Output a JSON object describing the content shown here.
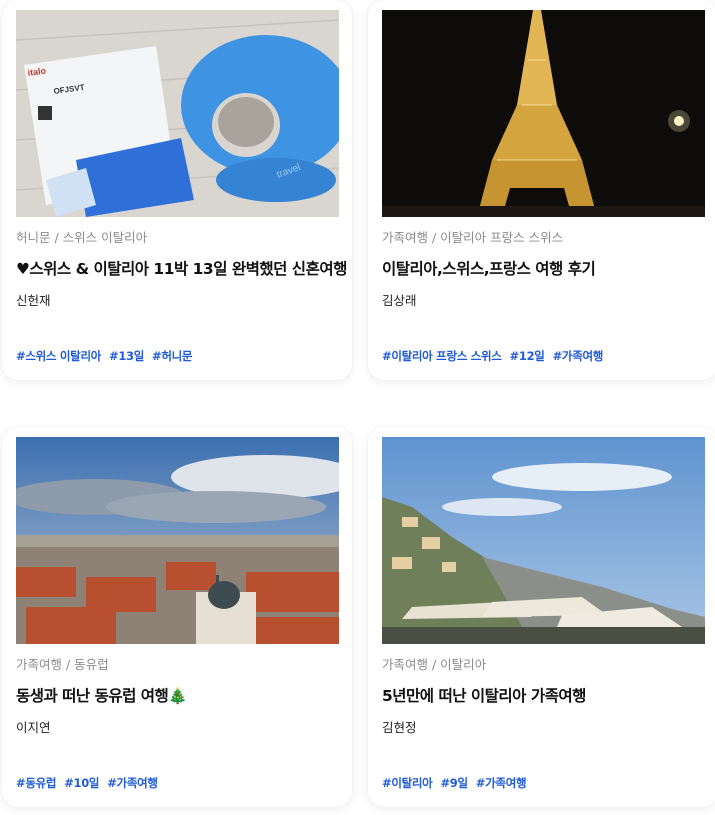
{
  "cards": [
    {
      "category": "허니문 / 스위스 이탈리아",
      "title": "♥스위스 & 이탈리아 11박 13일 완벽했던 신혼여행",
      "author": "신헌재",
      "tags": [
        "#스위스 이탈리아",
        "#13일",
        "#허니문"
      ],
      "photo": "neck-pillow-ticket-photo"
    },
    {
      "category": "가족여행 / 이탈리아 프랑스 스위스",
      "title": "이탈리아,스위스,프랑스 여행 후기",
      "author": "김상래",
      "tags": [
        "#이탈리아 프랑스 스위스",
        "#12일",
        "#가족여행"
      ],
      "photo": "eiffel-tower-night-photo"
    },
    {
      "category": "가족여행 / 동유럽",
      "title": "동생과 떠난 동유럽 여행🎄",
      "author": "이지연",
      "tags": [
        "#동유럽",
        "#10일",
        "#가족여행"
      ],
      "photo": "prague-rooftops-photo"
    },
    {
      "category": "가족여행 / 이탈리아",
      "title": "5년만에 떠난 이탈리아 가족여행",
      "author": "김현정",
      "tags": [
        "#이탈리아",
        "#9일",
        "#가족여행"
      ],
      "photo": "amalfi-coast-photo"
    }
  ],
  "photo_text": {
    "ticket_brand": "italo",
    "ticket_code": "OFJSVT",
    "pillow_brand": "travel"
  },
  "colors": {
    "tag": "#1f5bd6",
    "category": "#8b8b8b"
  }
}
